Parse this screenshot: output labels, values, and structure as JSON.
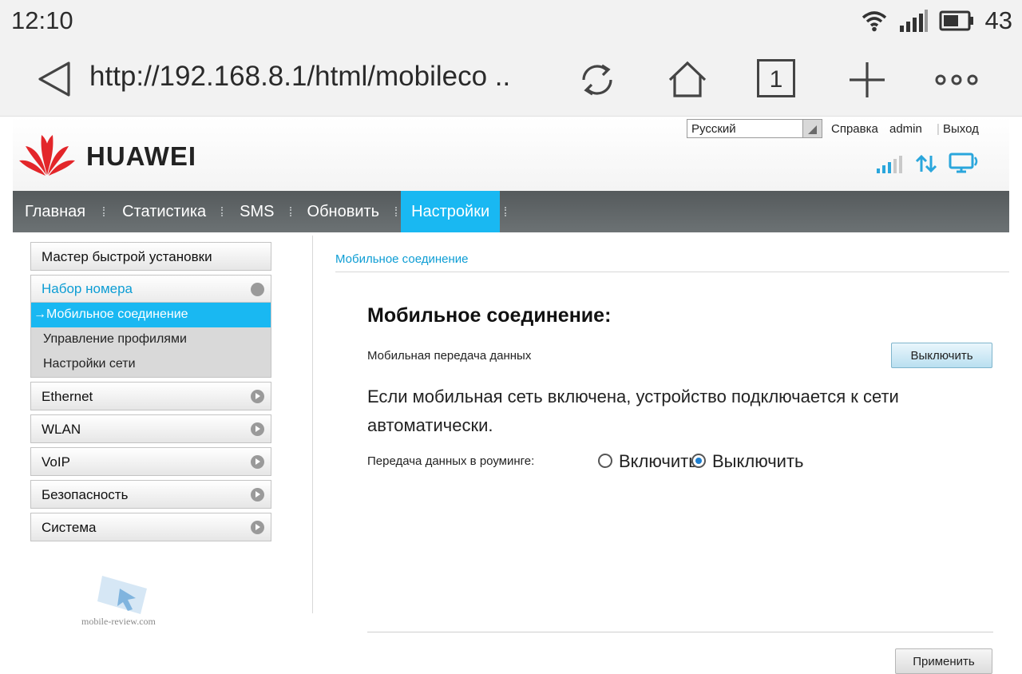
{
  "status_bar": {
    "time": "12:10",
    "battery": "43"
  },
  "browser": {
    "url": "http://192.168.8.1/html/mobileco ..",
    "tab_count": "1"
  },
  "header": {
    "brand": "HUAWEI",
    "language": "Русский",
    "links": {
      "help": "Справка",
      "user": "admin",
      "logout": "Выход"
    }
  },
  "nav": {
    "items": [
      {
        "label": "Главная"
      },
      {
        "label": "Статистика"
      },
      {
        "label": "SMS"
      },
      {
        "label": "Обновить"
      },
      {
        "label": "Настройки"
      }
    ],
    "active": "Настройки"
  },
  "sidebar": {
    "wizard": "Мастер быстрой установки",
    "dial_group": {
      "label": "Набор номера",
      "items": [
        "→Мобильное соединение",
        "Управление профилями",
        "Настройки сети"
      ]
    },
    "groups": [
      "Ethernet",
      "WLAN",
      "VoIP",
      "Безопасность",
      "Система"
    ]
  },
  "content": {
    "breadcrumb": "Мобильное соединение",
    "title": "Мобильное соединение:",
    "mobile_data_label": "Мобильная передача данных",
    "mobile_data_button": "Выключить",
    "info": "Если мобильная сеть включена, устройство подключается к сети автоматически.",
    "roaming_label": "Передача данных в роуминге:",
    "roaming_on": "Включить",
    "roaming_off": "Выключить",
    "roaming_selected": "Выключить",
    "apply_button": "Применить"
  },
  "watermark": {
    "text": "mobile-review.com"
  },
  "colors": {
    "accent": "#19b8f2",
    "link": "#0d9dd4",
    "nav_bg": "#5f6466"
  }
}
